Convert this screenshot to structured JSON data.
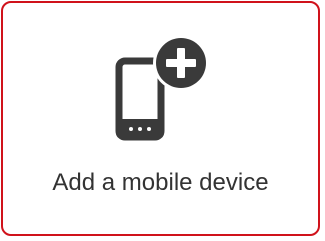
{
  "card": {
    "label": "Add a mobile device",
    "icon": "mobile-add-icon",
    "border_color": "#d0121b",
    "icon_color": "#3a3a3a"
  }
}
